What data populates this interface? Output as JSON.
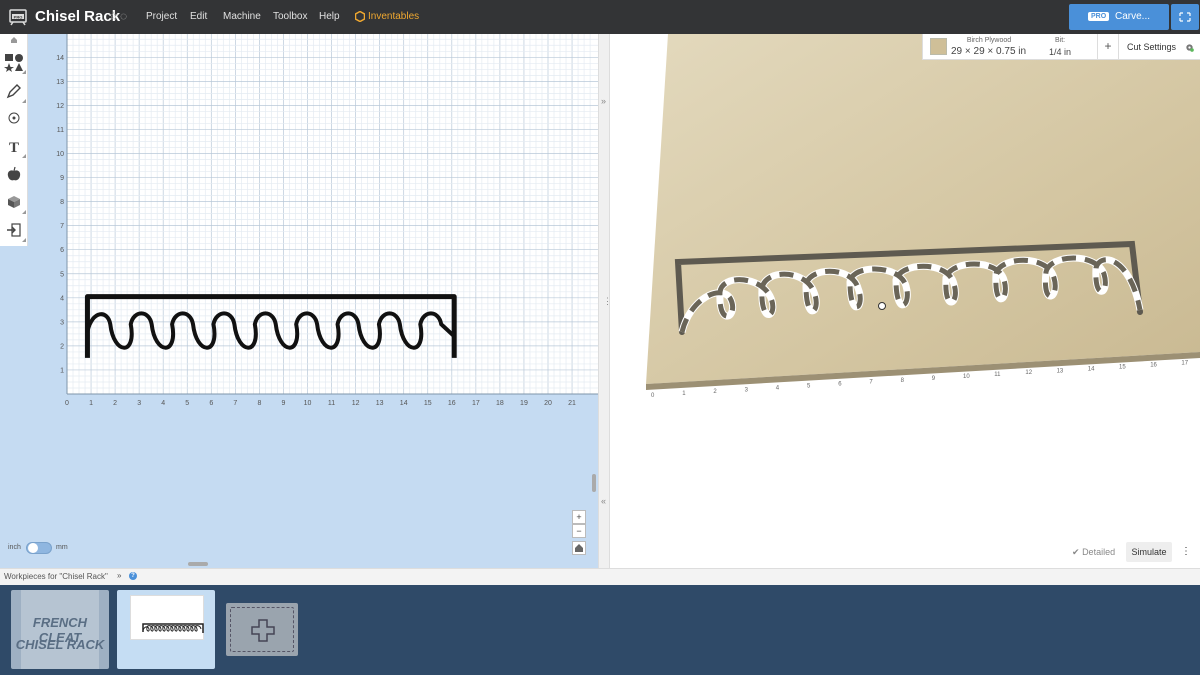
{
  "app": {
    "title": "Chisel Rack",
    "menu": [
      "Project",
      "Edit",
      "Machine",
      "Toolbox",
      "Help",
      "Inventables"
    ],
    "carve_button": {
      "badge": "PRO",
      "label": "Carve..."
    }
  },
  "toolbar": {
    "tools": [
      "home-icon",
      "shapes-icon",
      "pen-icon",
      "target-icon",
      "text-icon",
      "apple-icon",
      "box-icon",
      "import-icon"
    ]
  },
  "canvas2d": {
    "x_ticks": [
      "0",
      "1",
      "2",
      "3",
      "4",
      "5",
      "6",
      "7",
      "8",
      "9",
      "10",
      "11",
      "12",
      "13",
      "14",
      "15",
      "16",
      "17",
      "18",
      "19",
      "20",
      "21"
    ],
    "y_ticks": [
      "1",
      "2",
      "3",
      "4",
      "5",
      "6",
      "7",
      "8",
      "9",
      "10",
      "11",
      "12",
      "13",
      "14"
    ],
    "units": {
      "left": "inch",
      "right": "mm"
    },
    "zoom": [
      "+",
      "−"
    ]
  },
  "material": {
    "name": "Birch Plywood",
    "size": "29 × 29 × 0.75 in",
    "bit_label": "Bit:",
    "bit_value": "1/4 in",
    "add_bit": "+",
    "cut_settings": "Cut Settings"
  },
  "preview3d": {
    "x_ticks": [
      "0",
      "1",
      "2",
      "3",
      "4",
      "5",
      "6",
      "7",
      "8",
      "9",
      "10",
      "11",
      "12",
      "13",
      "14",
      "15",
      "16",
      "17"
    ],
    "detailed_label": "Detailed",
    "simulate_label": "Simulate",
    "more_label": "⋮"
  },
  "workpieces": {
    "header": "Workpieces for \"Chisel Rack\"",
    "chevron": "»",
    "items": [
      {
        "line1": "FRENCH CLEAT",
        "line2": "CHISEL RACK"
      },
      {
        "line1": "",
        "line2": ""
      }
    ]
  },
  "colors": {
    "topbar": "#333436",
    "accent": "#4a90d9",
    "canvas": "#c5dbf2",
    "wood": "#d6c9a8",
    "inventables": "#f0a830"
  }
}
